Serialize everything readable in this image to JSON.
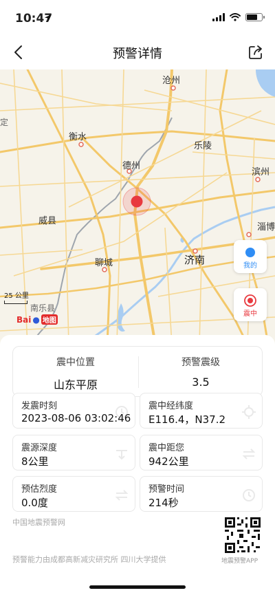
{
  "status_bar": {
    "time": "10:47",
    "icons": [
      "location-arrow-icon",
      "signal-icon",
      "wifi-icon",
      "battery-icon"
    ]
  },
  "nav": {
    "title": "预警详情",
    "back_icon": "chevron-left-icon",
    "share_icon": "share-icon"
  },
  "map": {
    "cities": {
      "cangzhou": "沧州",
      "hengshui": "衡水",
      "leling": "乐陵",
      "dezhou": "德州",
      "binzhou": "滨州",
      "weixian": "威县",
      "zibo": "淄博",
      "liaocheng": "聊城",
      "jinan": "济南",
      "nanle": "南乐县",
      "edge_left": "定"
    },
    "scale_label": "25 公里",
    "logo": {
      "bai": "Bai",
      "du": "du",
      "di": "地图"
    },
    "buttons": {
      "my_location": "我的",
      "epicenter": "震中"
    },
    "colors": {
      "epicenter": "#e8393f",
      "my_location_dot": "#2f8df5",
      "road": "#f3c86a",
      "water": "#a9cdf2"
    }
  },
  "info": {
    "location_label": "震中位置",
    "location_value": "山东平原",
    "magnitude_label": "预警震级",
    "magnitude_value": "3.5",
    "time_label": "发震时刻",
    "time_value": "2023-08-06 03:02:46",
    "coord_label": "震中经纬度",
    "coord_value": "E116.4，N37.2",
    "depth_label": "震源深度",
    "depth_value": "8公里",
    "distance_label": "震中距您",
    "distance_value": "942公里",
    "intensity_label": "预估烈度",
    "intensity_value": "0.0度",
    "warning_time_label": "预警时间",
    "warning_time_value": "214秒",
    "source": "中国地震预警网",
    "credit": "预警能力由成都高新减灾研究所 四川大学提供",
    "qr_label": "地震预警APP"
  }
}
